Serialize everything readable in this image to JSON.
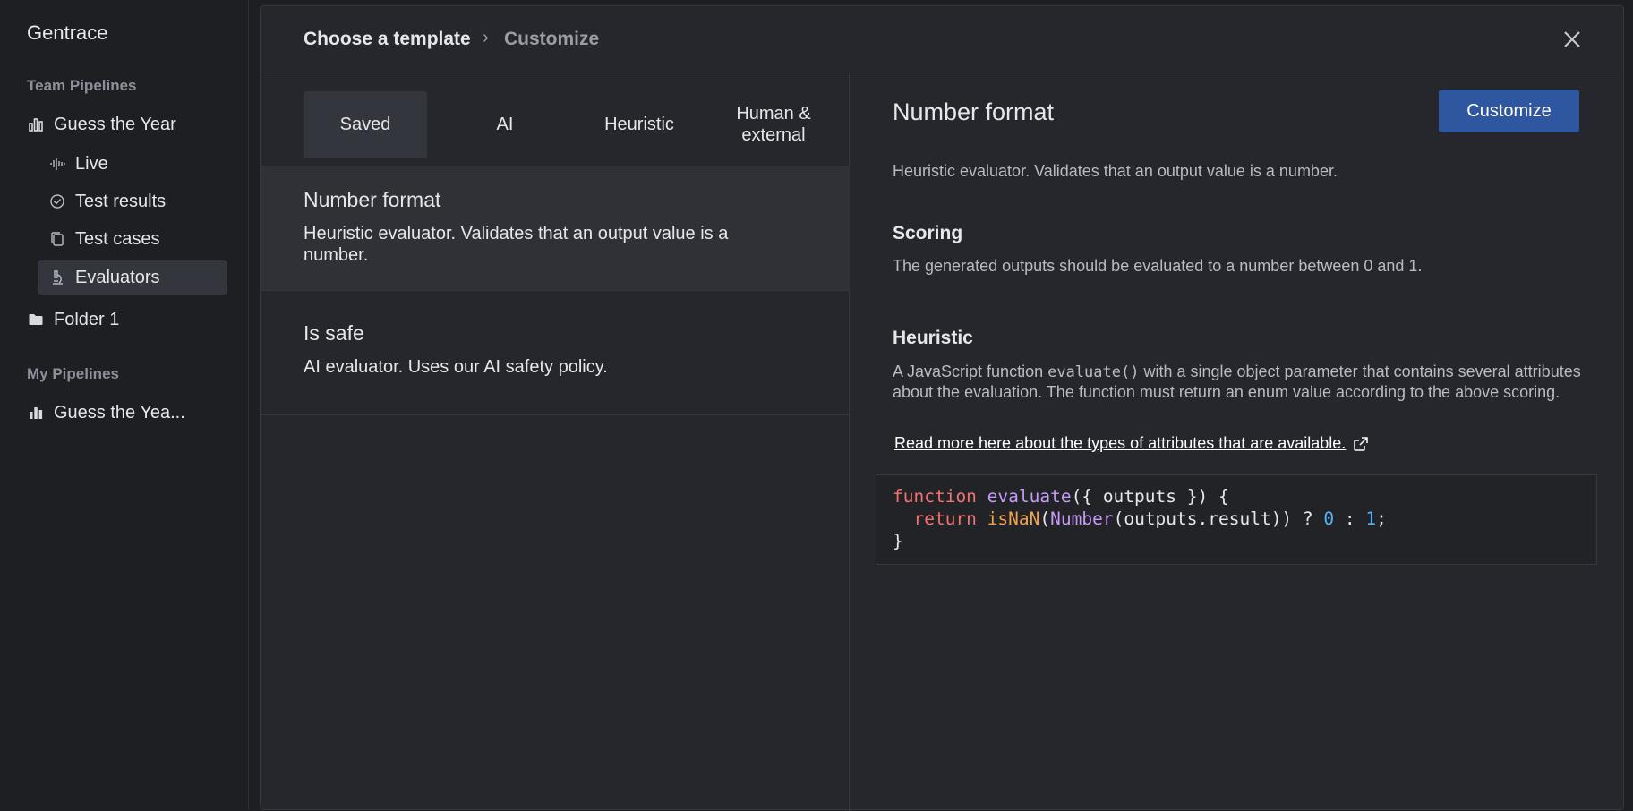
{
  "sidebar": {
    "brand": "Gentrace",
    "team_section": "Team Pipelines",
    "team_pipeline": "Guess the Year",
    "sub_items": [
      {
        "label": "Live",
        "icon": "waveform-icon"
      },
      {
        "label": "Test results",
        "icon": "check-circle-icon"
      },
      {
        "label": "Test cases",
        "icon": "copy-icon"
      },
      {
        "label": "Evaluators",
        "icon": "microscope-icon"
      }
    ],
    "folder": "Folder 1",
    "my_section": "My Pipelines",
    "my_pipeline": "Guess the Yea..."
  },
  "modal": {
    "breadcrumb": {
      "step1": "Choose a template",
      "separator": "›",
      "step2": "Customize"
    },
    "tabs": [
      "Saved",
      "AI",
      "Heuristic",
      "Human & external"
    ],
    "active_tab": "Saved",
    "templates": [
      {
        "title": "Number format",
        "desc": "Heuristic evaluator. Validates that an output value is a number."
      },
      {
        "title": "Is safe",
        "desc": "AI evaluator. Uses our AI safety policy."
      }
    ],
    "detail": {
      "title": "Number format",
      "customize_label": "Customize",
      "subtitle": "Heuristic evaluator. Validates that an output value is a number.",
      "scoring_heading": "Scoring",
      "scoring_text": "The generated outputs should be evaluated to a number between 0 and 1.",
      "heuristic_heading": "Heuristic",
      "heuristic_text_before": "A JavaScript function ",
      "heuristic_code": "evaluate()",
      "heuristic_text_after": " with a single object parameter that contains several attributes about the evaluation. The function must return an enum value according to the above scoring.",
      "link_text": "Read more here about the types of attributes that are available.",
      "code": {
        "line1_kw": "function",
        "line1_fn": "evaluate",
        "line1_rest": "({ outputs }) {",
        "line2_kw": "return",
        "line2_fn1": "isNaN",
        "line2_p1": "(",
        "line2_fn2": "Number",
        "line2_rest": "(outputs.result)) ? ",
        "line2_n0": "0",
        "line2_colon": " : ",
        "line2_n1": "1",
        "line2_end": ";",
        "line3": "}"
      }
    }
  },
  "colors": {
    "accent": "#2f57a0",
    "keyword": "#f2736f",
    "function": "#c79af7",
    "number": "#56b2f5"
  }
}
